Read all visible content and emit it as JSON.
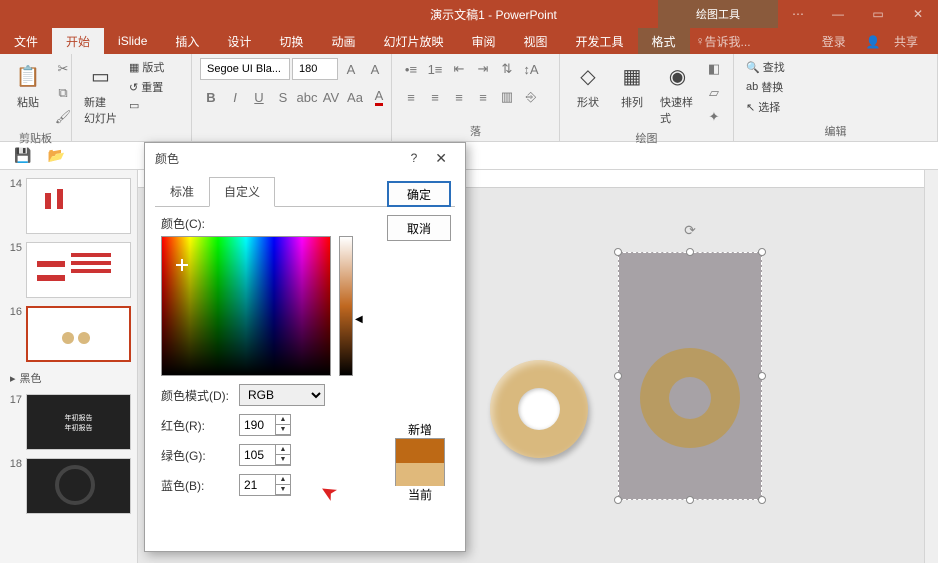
{
  "titlebar": {
    "title": "演示文稿1 - PowerPoint",
    "tools_label": "绘图工具"
  },
  "wincontrols": {
    "restore": "▭",
    "minimize": "—",
    "close": "✕",
    "options": "⋯"
  },
  "tabs": {
    "file": "文件",
    "home": "开始",
    "islide": "iSlide",
    "insert": "插入",
    "design": "设计",
    "transition": "切换",
    "animation": "动画",
    "slideshow": "幻灯片放映",
    "review": "审阅",
    "view": "视图",
    "developer": "开发工具",
    "format": "格式",
    "tell_me": "告诉我...",
    "login": "登录",
    "share": "共享"
  },
  "ribbon": {
    "clipboard": {
      "paste": "粘贴",
      "label": "剪贴板"
    },
    "slides": {
      "new": "新建\n幻灯片",
      "layout": "版式",
      "reset": "重置",
      "label": ""
    },
    "font": {
      "name": "Segoe UI Bla...",
      "size": "180"
    },
    "paragraph": {
      "label": "落"
    },
    "drawing": {
      "shape": "形状",
      "arrange": "排列",
      "quickstyle": "快速样式",
      "label": "绘图"
    },
    "editing": {
      "find": "查找",
      "replace": "替换",
      "select": "选择",
      "label": "编辑"
    }
  },
  "thumbs": {
    "t14": "14",
    "t15": "15",
    "t16": "16",
    "section": "黑色",
    "t17": "17",
    "t18": "18"
  },
  "dialog": {
    "title": "颜色",
    "help": "?",
    "close": "✕",
    "tab_standard": "标准",
    "tab_custom": "自定义",
    "ok": "确定",
    "cancel": "取消",
    "colors_label": "颜色(C):",
    "mode_label": "颜色模式(D):",
    "mode_value": "RGB",
    "r_label": "红色(R):",
    "r_value": "190",
    "g_label": "绿色(G):",
    "g_value": "105",
    "b_label": "蓝色(B):",
    "b_value": "21",
    "preview_new": "新增",
    "preview_cur": "当前"
  }
}
